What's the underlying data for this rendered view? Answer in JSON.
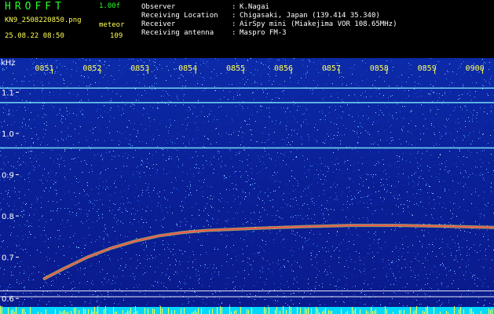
{
  "header": {
    "app_title": "HROFFT",
    "version": "1.00f",
    "filename": "KN9_2508220850.png",
    "meteor_label": "meteor",
    "datetime": "25.08.22 08:50",
    "meteor_count": "109"
  },
  "observation": {
    "rows": [
      {
        "label": "Observer",
        "value": "K.Nagai"
      },
      {
        "label": "Receiving Location",
        "value": "Chigasaki, Japan (139.414 35.340)"
      },
      {
        "label": "Receiver",
        "value": "AirSpy mini (Miakejima VOR 108.65MHz)"
      },
      {
        "label": "Receiving antenna",
        "value": "Maspro FM-3"
      }
    ]
  },
  "spectrogram": {
    "y_unit": "kHz",
    "y_ticks": [
      "1.1",
      "1.0",
      "0.9",
      "0.8",
      "0.7",
      "0.6"
    ],
    "y_tick_values": [
      1.1,
      1.0,
      0.9,
      0.8,
      0.7,
      0.6
    ],
    "y_range": [
      0.585,
      1.16
    ],
    "time_ticks": [
      "0851",
      "0852",
      "0853",
      "0854",
      "0855",
      "0856",
      "0857",
      "0858",
      "0859",
      "0900"
    ],
    "time_tick_values": [
      0.5,
      1.5,
      2.5,
      3.5,
      4.5,
      5.5,
      6.5,
      7.5,
      8.5,
      9.5
    ],
    "time_range": [
      0,
      10
    ],
    "carrier_lines_khz": [
      1.11,
      1.075,
      0.965
    ],
    "reference_lines_khz": [
      0.618,
      0.604
    ],
    "meteor_trace": [
      {
        "t": 0.6,
        "f": 0.648
      },
      {
        "t": 1.0,
        "f": 0.672
      },
      {
        "t": 1.5,
        "f": 0.7
      },
      {
        "t": 2.0,
        "f": 0.722
      },
      {
        "t": 2.5,
        "f": 0.739
      },
      {
        "t": 3.0,
        "f": 0.752
      },
      {
        "t": 3.5,
        "f": 0.76
      },
      {
        "t": 4.0,
        "f": 0.765
      },
      {
        "t": 5.0,
        "f": 0.77
      },
      {
        "t": 6.0,
        "f": 0.774
      },
      {
        "t": 7.0,
        "f": 0.777
      },
      {
        "t": 8.0,
        "f": 0.777
      },
      {
        "t": 9.0,
        "f": 0.775
      },
      {
        "t": 10.0,
        "f": 0.772
      }
    ],
    "colors": {
      "background": "#0a1a8c",
      "noise_hi": "#4fb8ff",
      "carrier": "#7ff0ff",
      "meteor_core": "#ff5050",
      "meteor_edge": "#ffff40",
      "tick_text": "#ffff55",
      "ref_line": "#ffffff",
      "bottom_band": "#00d8ff"
    }
  }
}
